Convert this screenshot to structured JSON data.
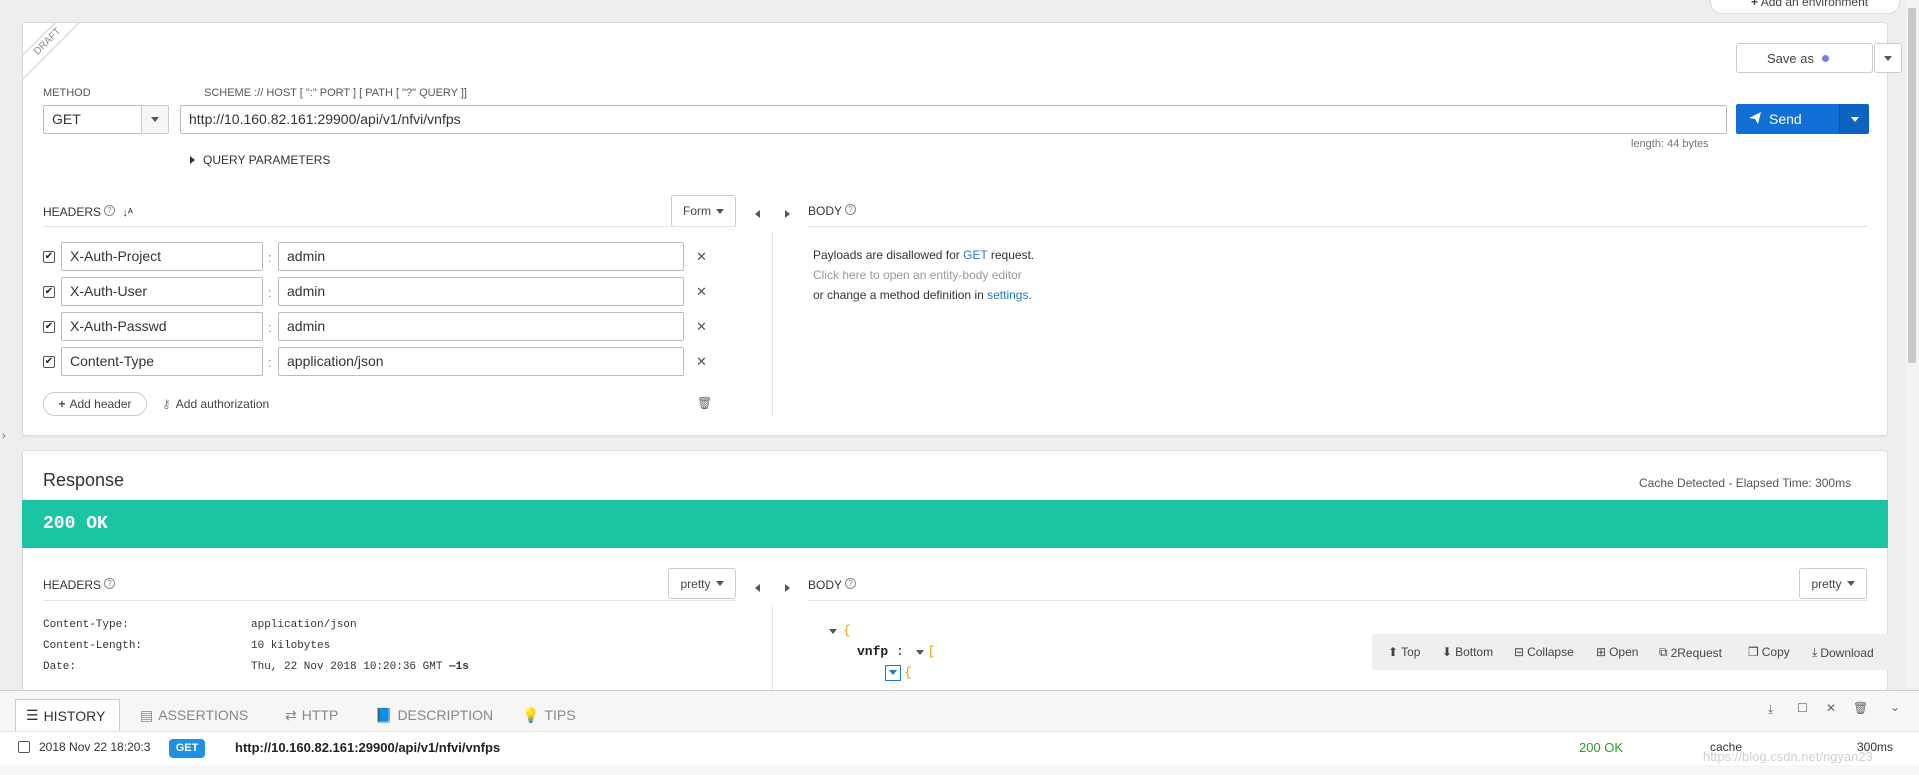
{
  "top": {
    "add_environment": "Add an environment"
  },
  "request": {
    "draft_ribbon": "DRAFT",
    "save_as": "Save as",
    "method_label": "METHOD",
    "method_value": "GET",
    "scheme_label": "SCHEME :// HOST [ \":\" PORT ] [ PATH [ \"?\" QUERY ]]",
    "url": "http://10.160.82.161:29900/api/v1/nfvi/vnfps",
    "send": "Send",
    "length": "length: 44 bytes",
    "query_params": "QUERY PARAMETERS",
    "headers_label": "HEADERS",
    "form_label": "Form",
    "headers": [
      {
        "name": "X-Auth-Project",
        "value": "admin"
      },
      {
        "name": "X-Auth-User",
        "value": "admin"
      },
      {
        "name": "X-Auth-Passwd",
        "value": "admin"
      },
      {
        "name": "Content-Type",
        "value": "application/json"
      }
    ],
    "add_header": "Add header",
    "add_authorization": "Add authorization",
    "body_label": "BODY",
    "body_line1_a": "Payloads are disallowed for ",
    "body_line1_method": "GET",
    "body_line1_b": " request.",
    "body_line2": "Click here to open an entity-body editor",
    "body_line3_a": "or change a method definition in ",
    "body_line3_link": "settings",
    "body_line3_b": "."
  },
  "response": {
    "title": "Response",
    "cache_info": "Cache Detected - Elapsed Time: 300ms",
    "status": "200 OK",
    "status_color": "#1bc5a4",
    "headers_label": "HEADERS",
    "pretty": "pretty",
    "headers": [
      {
        "name": "Content-Type:",
        "value": "application/json"
      },
      {
        "name": "Content-Length:",
        "value": "10 kilobytes"
      },
      {
        "name": "Date:",
        "value": "Thu, 22 Nov 2018 10:20:36 GMT",
        "extra": "—1s"
      }
    ],
    "body_label": "BODY",
    "json_open": "{",
    "json_key": "vnfp",
    "json_colon": ":",
    "json_arr": "[",
    "json_obj": "{",
    "toolbar": [
      "Top",
      "Bottom",
      "Collapse",
      "Open",
      "2Request",
      "Copy",
      "Download"
    ]
  },
  "bottom": {
    "tabs": [
      "HISTORY",
      "ASSERTIONS",
      "HTTP",
      "DESCRIPTION",
      "TIPS"
    ],
    "history": {
      "date": "2018 Nov 22 18:20:3",
      "method": "GET",
      "url": "http://10.160.82.161:29900/api/v1/nfvi/vnfps",
      "status": "200 OK",
      "cache": "cache",
      "time": "300ms"
    },
    "watermark": "https://blog.csdn.net/ngyan23"
  },
  "colors": {
    "accent": "#1070d6",
    "link": "#1f7ac4",
    "success": "#1bc5a4",
    "ok_text": "#2a9d2a"
  }
}
